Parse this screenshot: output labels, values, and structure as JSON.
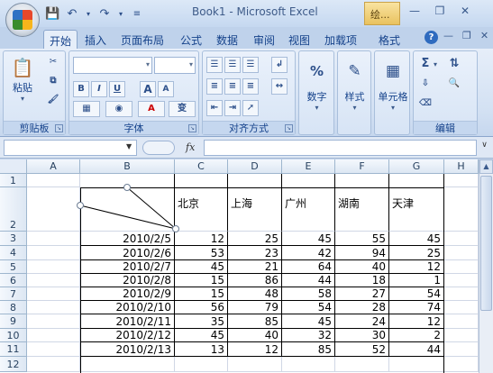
{
  "window": {
    "title": "Book1 - Microsoft Excel",
    "context_tab": "绘..."
  },
  "qat": {
    "save_icon": "save-icon",
    "undo_icon": "undo-icon",
    "redo_icon": "redo-icon"
  },
  "tabs": [
    {
      "label": "开始",
      "active": true
    },
    {
      "label": "插入"
    },
    {
      "label": "页面布局"
    },
    {
      "label": "公式"
    },
    {
      "label": "数据"
    },
    {
      "label": "审阅"
    },
    {
      "label": "视图"
    },
    {
      "label": "加载项"
    },
    {
      "label": "格式"
    }
  ],
  "ribbon": {
    "clipboard": {
      "label": "剪贴板",
      "paste": "粘贴"
    },
    "font": {
      "label": "字体",
      "bold": "B",
      "italic": "I",
      "underline": "U",
      "grow": "A",
      "shrink": "A",
      "color": "A",
      "phonetic": "变"
    },
    "alignment": {
      "label": "对齐方式"
    },
    "number": {
      "button": "数字",
      "icon": "%"
    },
    "styles": {
      "button": "样式"
    },
    "cells": {
      "button": "单元格"
    },
    "editing": {
      "label": "编辑"
    }
  },
  "formula_bar": {
    "name_box": "",
    "fx": "fx",
    "formula": ""
  },
  "grid": {
    "columns": [
      "A",
      "B",
      "C",
      "D",
      "E",
      "F",
      "G",
      "H"
    ],
    "rows": [
      "1",
      "2",
      "3",
      "4",
      "5",
      "6",
      "7",
      "8",
      "9",
      "10",
      "11",
      "12"
    ],
    "headers": [
      "北京",
      "上海",
      "广州",
      "湖南",
      "天津"
    ],
    "data": [
      {
        "date": "2010/2/5",
        "values": [
          "12",
          "25",
          "45",
          "55",
          "45"
        ]
      },
      {
        "date": "2010/2/6",
        "values": [
          "53",
          "23",
          "42",
          "94",
          "25"
        ]
      },
      {
        "date": "2010/2/7",
        "values": [
          "45",
          "21",
          "64",
          "40",
          "12"
        ]
      },
      {
        "date": "2010/2/8",
        "values": [
          "15",
          "86",
          "44",
          "18",
          "1"
        ]
      },
      {
        "date": "2010/2/9",
        "values": [
          "15",
          "48",
          "58",
          "27",
          "54"
        ]
      },
      {
        "date": "2010/2/10",
        "values": [
          "56",
          "79",
          "54",
          "28",
          "74"
        ]
      },
      {
        "date": "2010/2/11",
        "values": [
          "35",
          "85",
          "45",
          "24",
          "12"
        ]
      },
      {
        "date": "2010/2/12",
        "values": [
          "45",
          "40",
          "32",
          "30",
          "2"
        ]
      },
      {
        "date": "2010/2/13",
        "values": [
          "13",
          "12",
          "85",
          "52",
          "44"
        ]
      }
    ]
  }
}
